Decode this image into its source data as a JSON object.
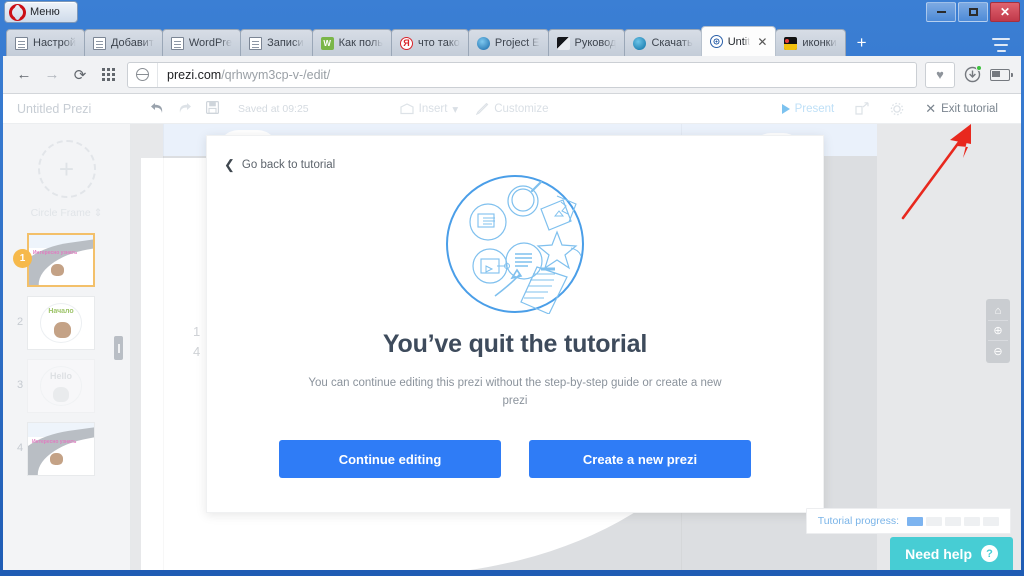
{
  "window": {
    "menu_label": "Меню",
    "minimize": "—",
    "maximize": "□",
    "close": "✕"
  },
  "tabs": [
    {
      "label": "Настрой",
      "favicon": "document-icon",
      "active": false
    },
    {
      "label": "Добавит",
      "favicon": "document-icon",
      "active": false
    },
    {
      "label": "WordPre",
      "favicon": "document-icon",
      "active": false
    },
    {
      "label": "Записи",
      "favicon": "document-icon",
      "active": false
    },
    {
      "label": "Как поль",
      "favicon": "word-icon",
      "active": false
    },
    {
      "label": "что тако",
      "favicon": "yandex-icon",
      "active": false
    },
    {
      "label": "Project E",
      "favicon": "blue-globe-icon",
      "active": false
    },
    {
      "label": "Руковод",
      "favicon": "dark-photo-icon",
      "active": false
    },
    {
      "label": "Скачать",
      "favicon": "teal-globe-icon",
      "active": false
    },
    {
      "label": "Untit",
      "favicon": "prezi-icon",
      "active": true,
      "close": "✕"
    },
    {
      "label": "иконки",
      "favicon": "image-icon",
      "active": false
    }
  ],
  "tabbar": {
    "new_tab": "+",
    "menu_icon": "hamburger-icon"
  },
  "navbar": {
    "back": "←",
    "forward": "→",
    "reload": "⟳",
    "speeddial": "grid-icon",
    "url_domain": "prezi.com",
    "url_path": "/qrhwym3cp-v-/edit/",
    "heart": "♥",
    "download_icon": "download-icon",
    "battery_icon": "battery-icon"
  },
  "prezi": {
    "toolbar": {
      "title": "Untitled Prezi",
      "undo": "↰",
      "redo": "↱",
      "save": "save-icon",
      "saved_status": "Saved at 09:25",
      "insert": "Insert",
      "insert_caret": "▾",
      "customize": "Customize",
      "present": "Present",
      "share": "share-icon",
      "settings": "gear-icon",
      "exit_tutorial": "Exit tutorial",
      "exit_icon": "✕"
    },
    "panel": {
      "add_plus": "+",
      "add_label": "Circle Frame",
      "add_caret": "⇕",
      "thumbnails": [
        {
          "number": "1",
          "selected": true,
          "caption": "Интересно узнать"
        },
        {
          "number": "2",
          "selected": false,
          "caption": "Начало"
        },
        {
          "number": "3",
          "selected": false,
          "caption": "Hello"
        },
        {
          "number": "4",
          "selected": false,
          "caption": "Интересно узнать"
        }
      ]
    },
    "canvas": {
      "marker_top": "1",
      "marker_bottom": "4"
    },
    "zoom_controls": [
      {
        "name": "home",
        "glyph": "⌂"
      },
      {
        "name": "zoom-in",
        "glyph": "⊕"
      },
      {
        "name": "zoom-out",
        "glyph": "⊖"
      }
    ],
    "tutorial_progress": {
      "label": "Tutorial progress:",
      "total_steps": 5,
      "completed_steps": 1
    },
    "need_help": {
      "label": "Need help",
      "icon": "?"
    }
  },
  "modal": {
    "back_link": "Go back to tutorial",
    "back_chevron": "❮",
    "illustration": "tutorial-circle-illustration",
    "title": "You’ve quit the tutorial",
    "subtitle": "You can continue editing this prezi without the step-by-step guide or create a new prezi",
    "primary_button": "Continue editing",
    "secondary_button": "Create a new prezi"
  },
  "annotation": {
    "arrow": "red-arrow-pointing-to-exit-tutorial"
  },
  "colors": {
    "accent_blue": "#2f7cf6",
    "teal": "#47cdd4",
    "orange_badge": "#f6b94b",
    "progress_blue": "#7db4f0",
    "arrow_red": "#e8281e"
  }
}
